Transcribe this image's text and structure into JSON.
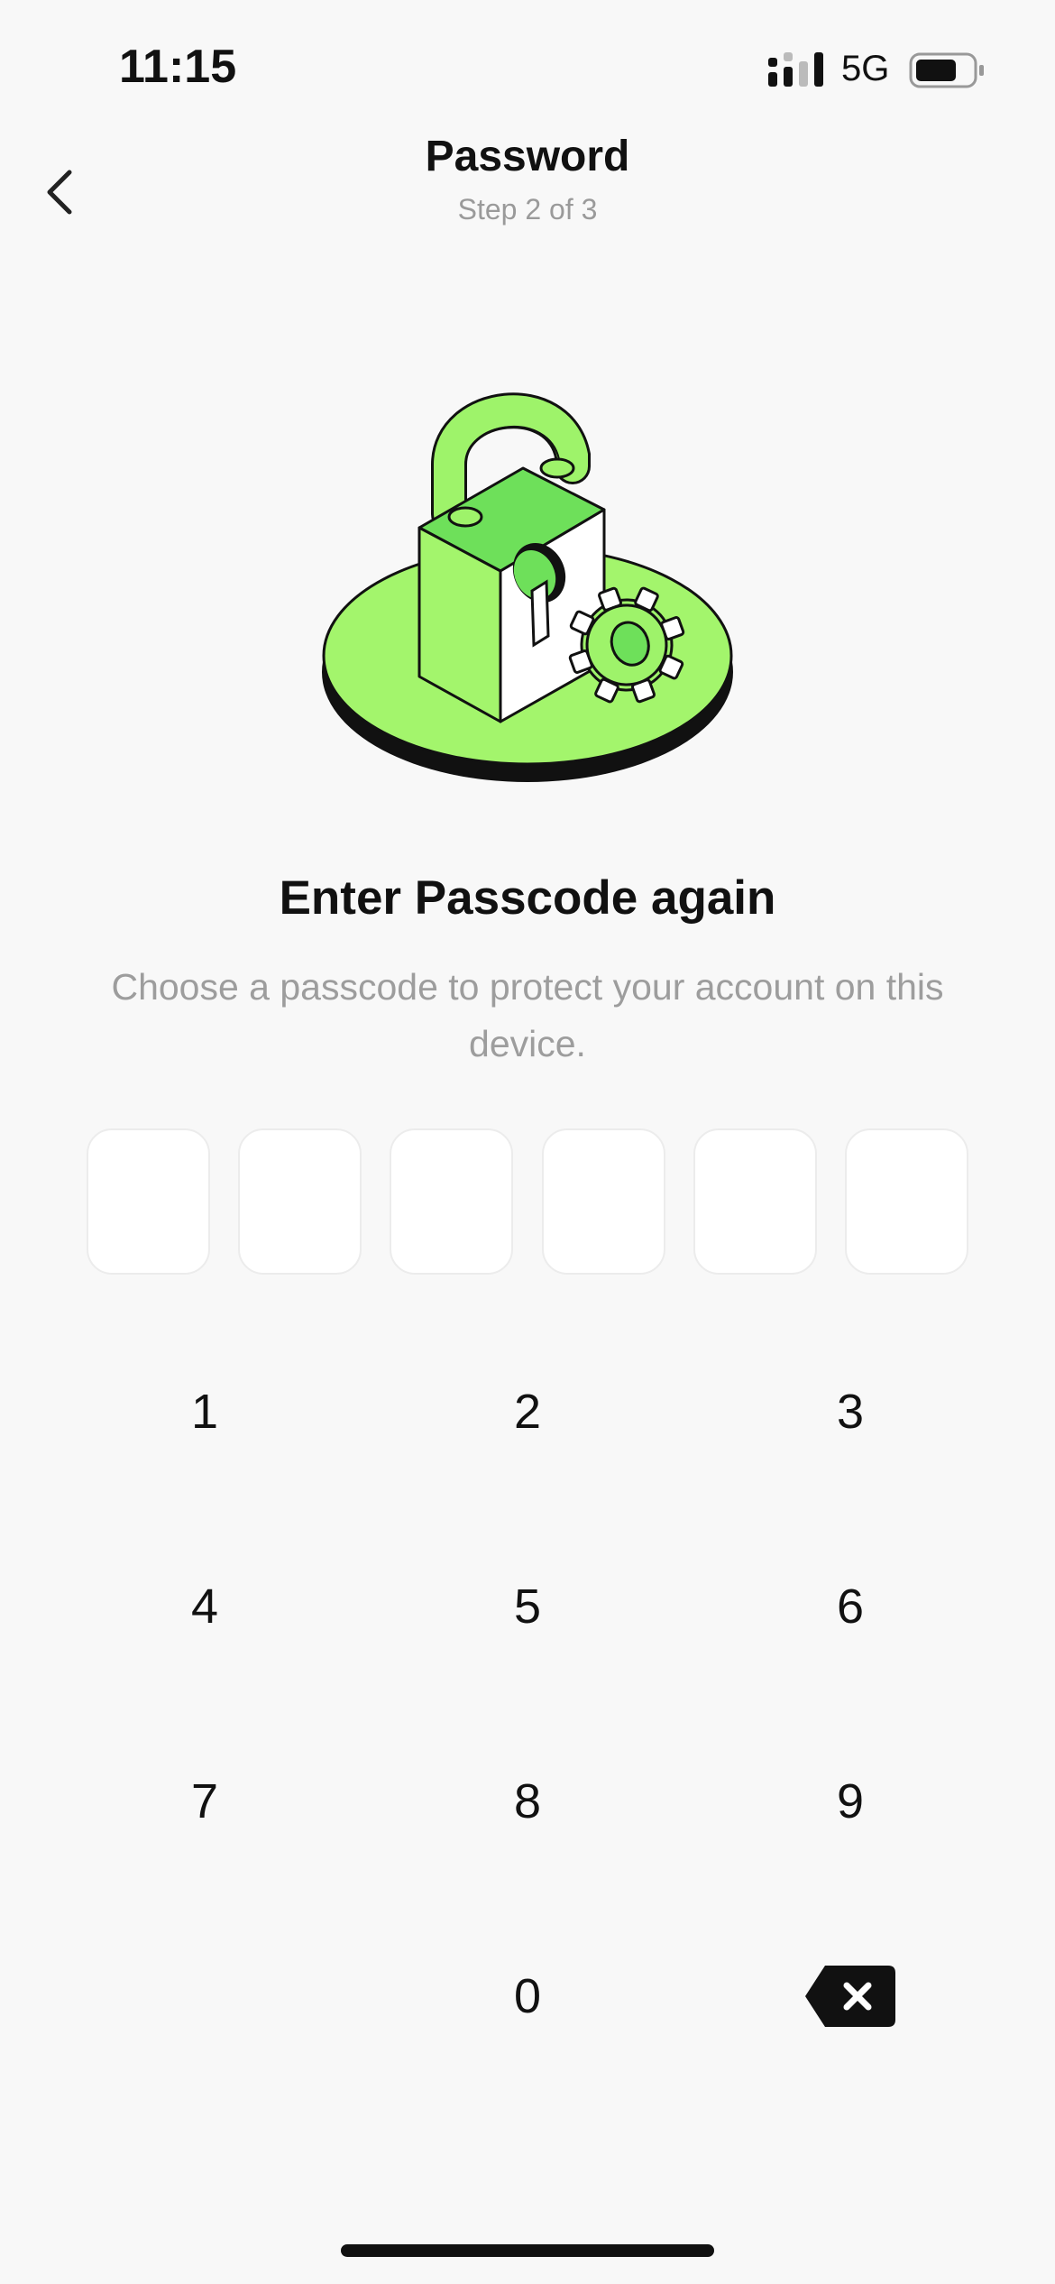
{
  "status_bar": {
    "time": "11:15",
    "network": "5G",
    "icons": [
      "signal-icon",
      "battery-icon"
    ]
  },
  "header": {
    "title": "Password",
    "step": "Step 2 of 3",
    "back_icon": "chevron-left-icon"
  },
  "illustration": {
    "icon": "padlock-gear-illustration",
    "colors": {
      "accent": "#9ef36a",
      "accent_dark": "#6ee05a",
      "outline": "#111111"
    }
  },
  "prompt": {
    "heading": "Enter Passcode again",
    "description": "Choose a passcode to protect your account on this device."
  },
  "passcode": {
    "length": 6,
    "entered": 0
  },
  "keypad": {
    "keys": [
      "1",
      "2",
      "3",
      "4",
      "5",
      "6",
      "7",
      "8",
      "9",
      "0"
    ],
    "delete_icon": "backspace-icon"
  }
}
